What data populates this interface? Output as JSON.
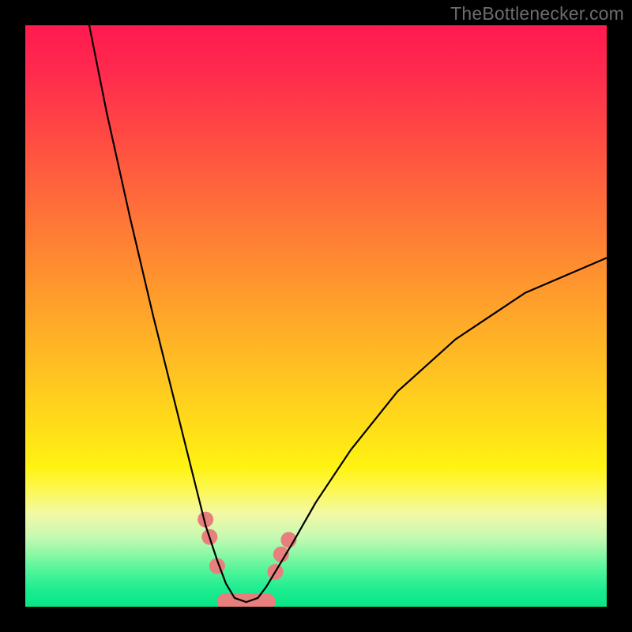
{
  "watermark": {
    "text": "TheBottlenecker.com"
  },
  "chart_data": {
    "type": "line",
    "title": "",
    "xlabel": "",
    "ylabel": "",
    "xlim": [
      0,
      100
    ],
    "ylim": [
      0,
      100
    ],
    "notes": "Bottleneck-style V-curve over red→green vertical gradient. Curve minimum (≈0) near x≈37; left branch reaches 100 at x≈11; right branch ≈60 at x=100. Coral dots+bar mark the low-bottleneck region near the trough.",
    "series": [
      {
        "name": "bottleneck-curve",
        "x": [
          11,
          14,
          18,
          22,
          26,
          29,
          31,
          33,
          34.5,
          36,
          38,
          40,
          41.5,
          43,
          46,
          50,
          56,
          64,
          74,
          86,
          100
        ],
        "y": [
          100,
          85,
          67,
          50,
          34,
          22,
          14,
          8,
          4,
          1.5,
          0.8,
          1.5,
          3.5,
          6,
          11,
          18,
          27,
          37,
          46,
          54,
          60
        ]
      }
    ],
    "markers": {
      "name": "sweet-spot-dots",
      "color": "#e77f7d",
      "points": [
        {
          "x": 31.0,
          "y": 15.0
        },
        {
          "x": 31.7,
          "y": 12.0
        },
        {
          "x": 33.0,
          "y": 7.0
        },
        {
          "x": 43.0,
          "y": 6.0
        },
        {
          "x": 44.0,
          "y": 9.0
        },
        {
          "x": 45.3,
          "y": 11.5
        }
      ]
    },
    "trough_bar": {
      "name": "sweet-spot-bar",
      "color": "#e77f7d",
      "x_start": 33.0,
      "x_end": 43.0,
      "y": 1.0
    }
  }
}
